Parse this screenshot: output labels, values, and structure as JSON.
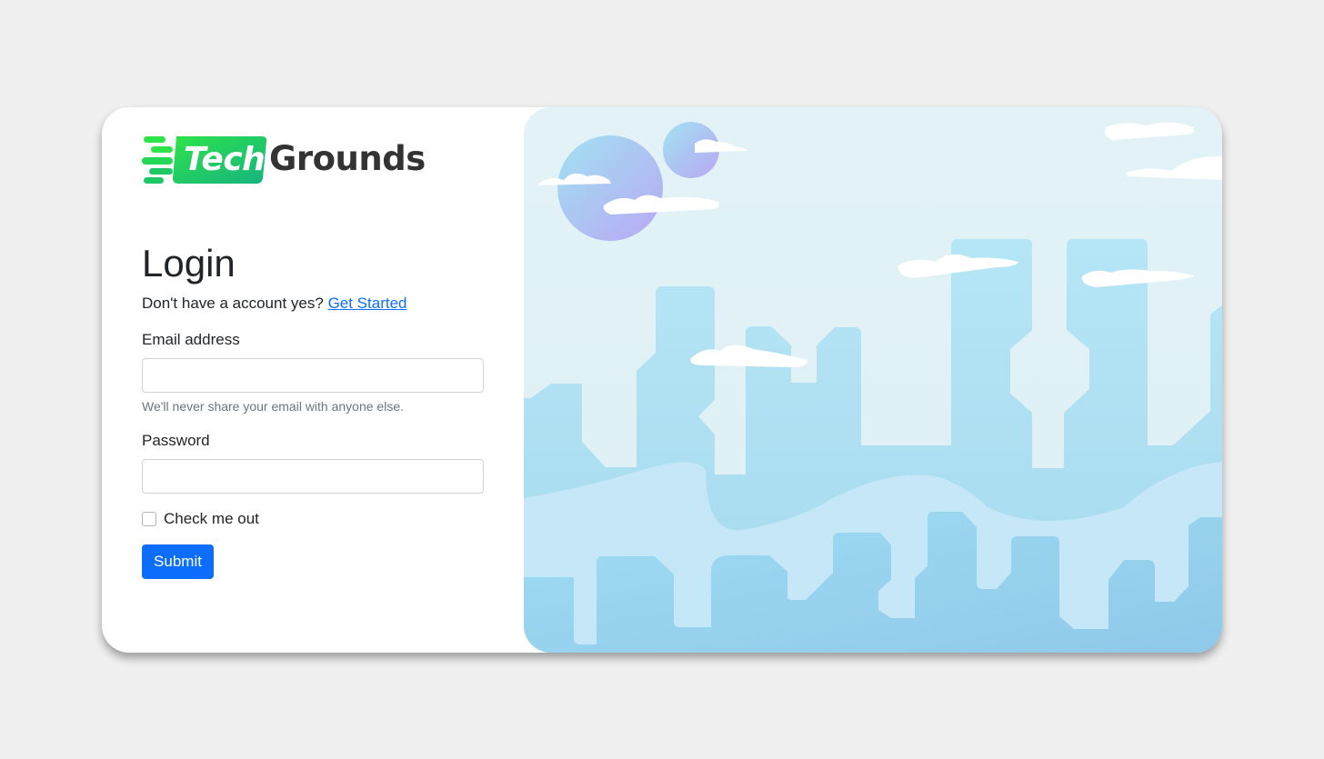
{
  "brand": {
    "tech": "Tech",
    "grounds": "Grounds"
  },
  "login": {
    "title": "Login",
    "subtitle_text": "Don't have a account yes?",
    "get_started_link": "Get Started",
    "email_label": "Email address",
    "email_value": "",
    "email_help": "We'll never share your email with anyone else.",
    "password_label": "Password",
    "password_value": "",
    "check_label": "Check me out",
    "submit_label": "Submit"
  },
  "colors": {
    "primary": "#0d6efd",
    "brand_green": "#1ec864",
    "sky": "#e1f1f7",
    "building": "#b3e3f4"
  },
  "illustration": {
    "icon": "city-skyline-illustration"
  }
}
